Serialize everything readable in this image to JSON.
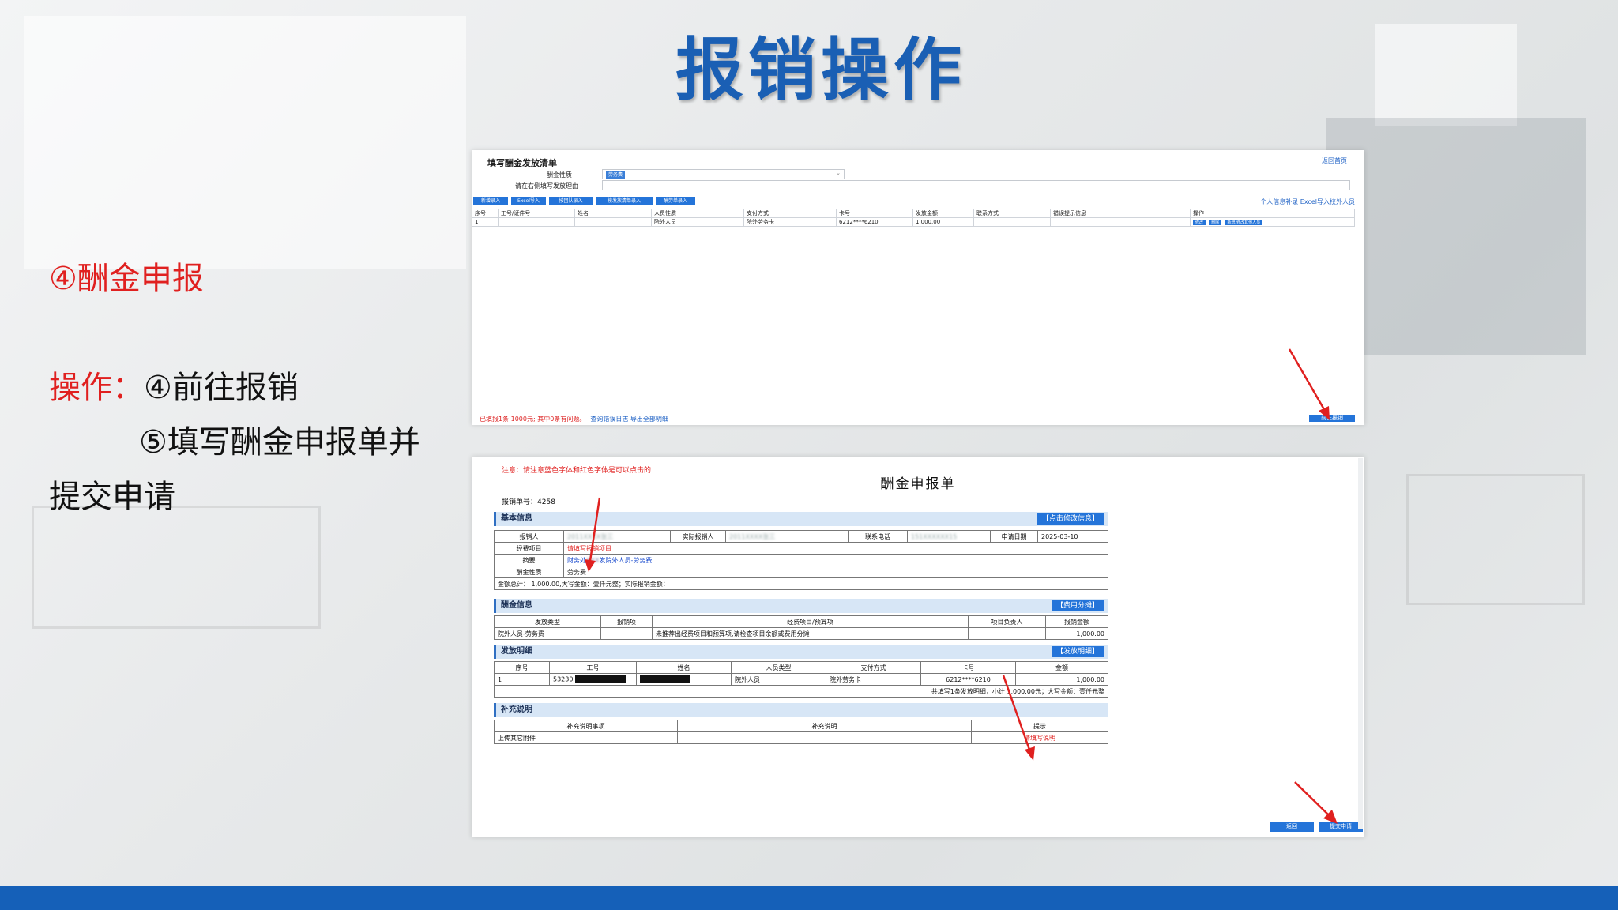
{
  "slide": {
    "title": "报销操作",
    "step_heading": "④酬金申报",
    "op_prefix": "操作：",
    "op_line1": "④前往报销",
    "op_line2": "⑤填写酬金申报单并",
    "op_line3": "提交申请"
  },
  "list_screen": {
    "title": "填写酬金发放清单",
    "back_link": "返回首页",
    "field1_label": "酬金性质",
    "field1_chip": "劳务费",
    "field2_label": "请在右侧填写发放理由",
    "toolbar": [
      "新增录入",
      "Excel导入",
      "按团队录入",
      "按发放清单录入",
      "酬劳单录入"
    ],
    "right_links": "个人信息补录  Excel导入校外人员",
    "columns": [
      "序号",
      "工号/证件号",
      "姓名",
      "人员性质",
      "支付方式",
      "卡号",
      "发放金额",
      "联系方式",
      "错误提示信息",
      "操作"
    ],
    "rows": [
      {
        "no": "1",
        "id": "",
        "name": "",
        "type": "院外人员",
        "pay": "院外劳务卡",
        "card": "6212****6210",
        "amount": "1,000.00",
        "contact": "",
        "err": ""
      }
    ],
    "row_actions": [
      "修改",
      "删除",
      "新增/修改其他人员"
    ],
    "footer_text": "已填报1条 1000元; 其中0条有问题。",
    "footer_links": "查询错误日志  导出全部明细",
    "next_button": "前往报销"
  },
  "form_screen": {
    "notice": "注意：请注意蓝色字体和红色字体是可以点击的",
    "title": "酬金申报单",
    "form_no_label": "报销单号：",
    "form_no": "4258",
    "basic": {
      "header": "基本信息",
      "edit_btn": "【点击修改信息】",
      "applicant_label": "报销人",
      "applicant": "2011XXXX张三",
      "actual_label": "实际报销人",
      "actual": "2011XXXX张三",
      "phone_label": "联系电话",
      "phone": "151XXXXXX15",
      "date_label": "申请日期",
      "date": "2025-03-10",
      "project_label": "经费项目",
      "project": "请填写报销项目",
      "summary_label": "摘要",
      "summary_prefix": "财务处",
      "summary_suffix": "发院外人员-劳务费",
      "nature_label": "酬金性质",
      "nature": "劳务费",
      "total": "金额总计：  1,000.00,大写金额：壹仟元整；实际报销金额："
    },
    "pay_info": {
      "header": "酬金信息",
      "btn": "【费用分摊】",
      "columns": [
        "发放类型",
        "报销项",
        "经费项目/预算项",
        "项目负责人",
        "报销金额"
      ],
      "row": {
        "type": "院外人员-劳务费",
        "item": "",
        "project": "未推荐出经费项目和预算项,请检查项目余额或费用分摊",
        "leader": "",
        "amount": "1,000.00"
      }
    },
    "detail": {
      "header": "发放明细",
      "btn": "【发放明细】",
      "columns": [
        "序号",
        "工号",
        "姓名",
        "人员类型",
        "支付方式",
        "卡号",
        "金额"
      ],
      "row": {
        "no": "1",
        "id": "53230",
        "name": "",
        "type": "院外人员",
        "pay": "院外劳务卡",
        "card": "6212****6210",
        "amount": "1,000.00"
      },
      "summary": "共填写1条发放明细，小计 1,000.00元；大写金额：壹仟元整"
    },
    "extra": {
      "header": "补充说明",
      "columns": [
        "补充说明事项",
        "补充说明",
        "提示"
      ],
      "row": {
        "item": "上传其它附件",
        "desc": "",
        "tip": "请填写说明"
      }
    },
    "back_button": "返回",
    "submit_button": "提交申请"
  },
  "colors": {
    "title_blue": "#1a5fb4",
    "accent_red": "#e0201f",
    "btn_blue": "#2474d9",
    "bottom_bar": "#1560b8"
  }
}
